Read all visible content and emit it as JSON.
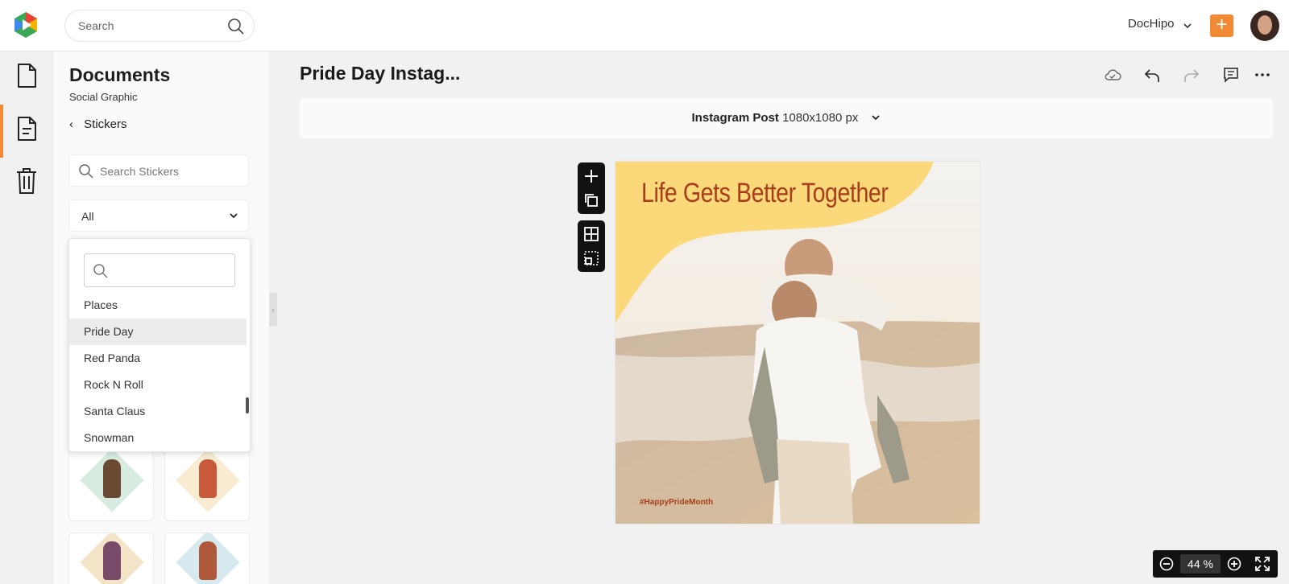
{
  "header": {
    "search_placeholder": "Search",
    "workspace_name": "DocHipo",
    "add_label": "+"
  },
  "sidebar": {
    "title": "Documents",
    "subtitle": "Social Graphic",
    "back_label": "Stickers",
    "sticker_search_placeholder": "Search Stickers",
    "category_selected": "All",
    "dropdown": {
      "search_value": "",
      "items": [
        "Places",
        "Pride Day",
        "Red Panda",
        "Rock N Roll",
        "Santa Claus",
        "Snowman"
      ],
      "highlighted": "Pride Day"
    }
  },
  "editor": {
    "document_title": "Pride Day Instag...",
    "size_name": "Instagram Post",
    "size_dims": "1080x1080 px",
    "canvas": {
      "headline": "Life Gets Better Together",
      "hashtag": "#HappyPrideMonth"
    },
    "zoom_value": "44",
    "zoom_unit": "%"
  },
  "colors": {
    "accent": "#f08a35",
    "headline": "#a83d1c",
    "blob": "#fbd97a"
  }
}
